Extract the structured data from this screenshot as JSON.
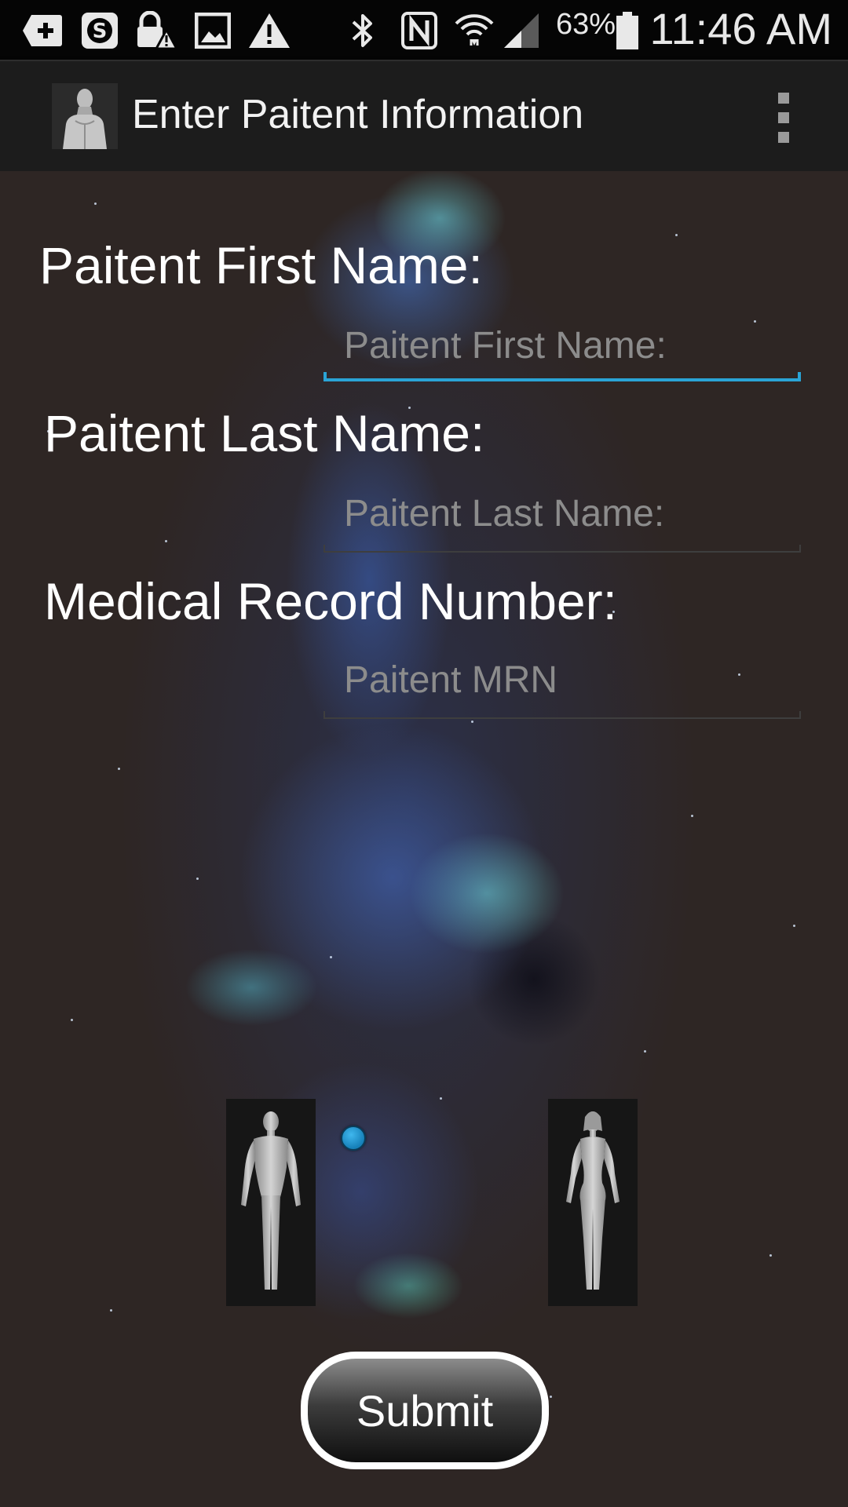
{
  "status_bar": {
    "icons": [
      "add-box-icon",
      "skype-icon",
      "lock-warning-icon",
      "image-icon",
      "warning-icon",
      "bluetooth-icon",
      "nfc-icon",
      "wifi-icon",
      "cellular-signal-icon",
      "battery-icon"
    ],
    "battery_percent": "63%",
    "time": "11:46 AM"
  },
  "action_bar": {
    "title": "Enter Paitent Information",
    "app_icon": "male-body-icon",
    "overflow_icon": "overflow-menu-icon"
  },
  "form": {
    "first_name": {
      "label": "Paitent First Name:",
      "placeholder": "Paitent First Name:",
      "value": "",
      "focused": true
    },
    "last_name": {
      "label": "Paitent Last Name:",
      "placeholder": "Paitent Last Name:",
      "value": ""
    },
    "mrn": {
      "label": "Medical Record Number:",
      "placeholder": "Paitent MRN",
      "value": ""
    }
  },
  "gender_selector": {
    "male_image": "male-body-figure",
    "female_image": "female-body-figure",
    "selected": "male"
  },
  "submit_label": "Submit",
  "colors": {
    "status_bar": "#050505",
    "action_bar": "#1c1c1c",
    "background": "#2e2624",
    "focus_accent": "#2aa4d6",
    "placeholder": "#8c8c8c"
  }
}
